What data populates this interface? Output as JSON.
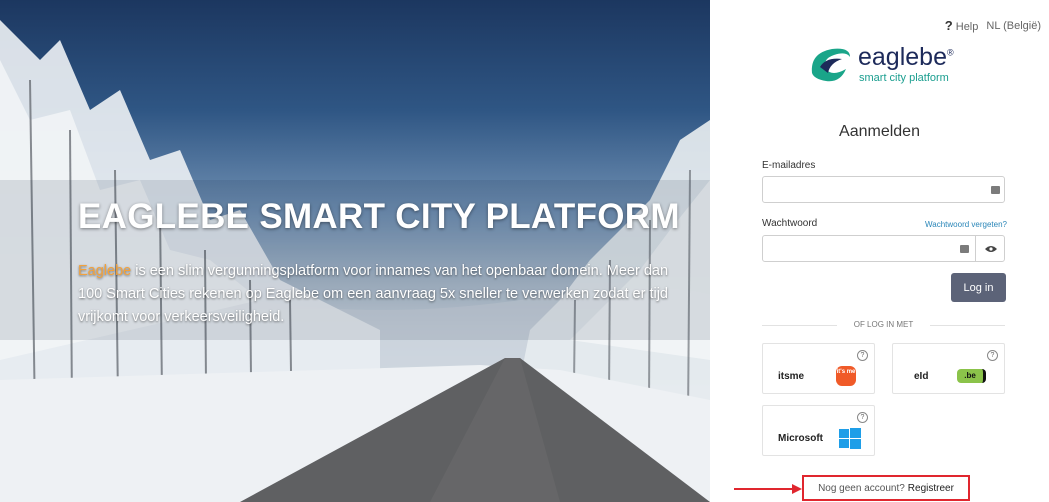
{
  "hero": {
    "title": "EAGLEBE SMART CITY PLATFORM",
    "brand_word": "Eaglebe",
    "description": " is een slim vergunningsplatform voor innames van het openbaar domein. Meer dan 100 Smart Cities rekenen op Eaglebe om een aanvraag 5x sneller te verwerken zodat er tijd vrijkomt voor verkeersveiligheid."
  },
  "topbar": {
    "help_label": "Help",
    "language": "NL (België)"
  },
  "logo": {
    "name": "eaglebe",
    "registered": "®",
    "tagline": "smart city platform"
  },
  "form": {
    "title": "Aanmelden",
    "email_label": "E-mailadres",
    "email_value": "",
    "password_label": "Wachtwoord",
    "password_value": "",
    "forgot_link": "Wachtwoord vergeten?",
    "login_button": "Log in"
  },
  "alt_login": {
    "divider": "OF LOG IN MET",
    "providers": [
      {
        "name": "itsme",
        "logo_text": "it's me"
      },
      {
        "name": "eId",
        "logo_text": ".be"
      },
      {
        "name": "Microsoft",
        "logo_text": ""
      }
    ]
  },
  "register": {
    "question": "Nog geen account?",
    "link": "Registreer"
  },
  "colors": {
    "accent_brand": "#f2a23d",
    "button": "#5c6378",
    "itsme": "#f05a28",
    "eid_green": "#8bc34a",
    "microsoft": "#1e9ee8",
    "highlight": "#e0262e"
  }
}
